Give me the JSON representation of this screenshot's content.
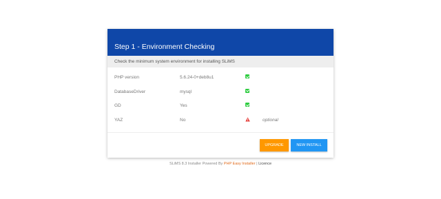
{
  "card": {
    "title": "Step 1 - Environment Checking",
    "subtitle": "Check the minimum system environment for installing SLiMS",
    "header_color": "#0f47a8"
  },
  "requirements": [
    {
      "name": "PHP version",
      "value": "5.6.24-0+deb8u1",
      "status": "ok",
      "status_icon": "check-icon",
      "note": ""
    },
    {
      "name": "DatabaseDriver",
      "value": "mysql",
      "status": "ok",
      "status_icon": "check-icon",
      "note": ""
    },
    {
      "name": "GD",
      "value": "Yes",
      "status": "ok",
      "status_icon": "check-icon",
      "note": ""
    },
    {
      "name": "YAZ",
      "value": "No",
      "status": "warning",
      "status_icon": "warning-icon",
      "note": "optional"
    }
  ],
  "buttons": {
    "upgrade_label": "UPGRADE",
    "upgrade_color": "#ff9800",
    "new_install_label": "NEW INSTALL",
    "new_install_color": "#2196f3"
  },
  "footer": {
    "prefix": "SLiMS 8.3 Installer Powered By",
    "installer_link": "PHP Easy Installer",
    "separator": "|",
    "licence_link": "Licence"
  }
}
